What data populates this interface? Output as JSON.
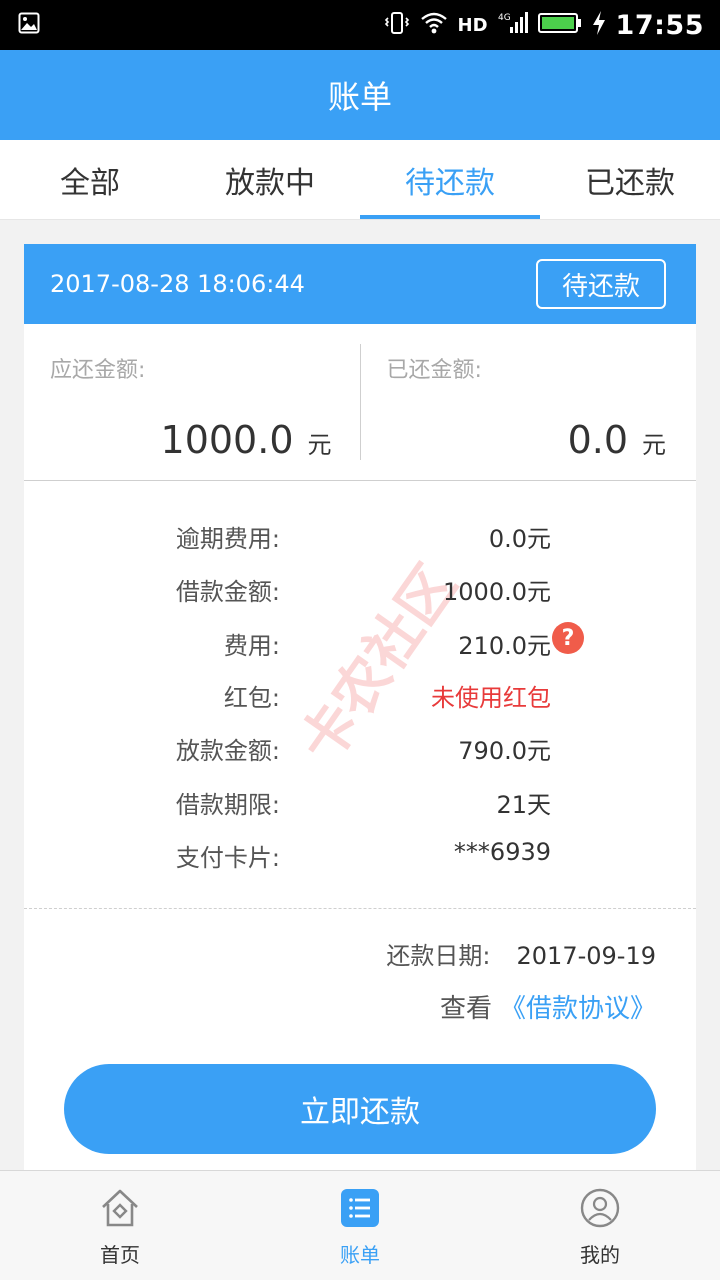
{
  "status_bar": {
    "network": "HD",
    "time": "17:55"
  },
  "header": {
    "title": "账单"
  },
  "tabs": [
    {
      "label": "全部",
      "active": false
    },
    {
      "label": "放款中",
      "active": false
    },
    {
      "label": "待还款",
      "active": true
    },
    {
      "label": "已还款",
      "active": false
    }
  ],
  "bill": {
    "datetime": "2017-08-28 18:06:44",
    "status": "待还款",
    "due_label": "应还金额:",
    "due_amount": "1000.0",
    "due_unit": "元",
    "paid_label": "已还金额:",
    "paid_amount": "0.0",
    "paid_unit": "元",
    "details": [
      {
        "label": "逾期费用:",
        "value": "0.0元"
      },
      {
        "label": "借款金额:",
        "value": "1000.0元"
      },
      {
        "label": "费用:",
        "value": "210.0元"
      },
      {
        "label": "红包:",
        "value": "未使用红包"
      },
      {
        "label": "放款金额:",
        "value": "790.0元"
      },
      {
        "label": "借款期限:",
        "value": "21天"
      },
      {
        "label": "支付卡片:",
        "value": "***6939"
      }
    ],
    "help_icon": "?",
    "watermark": "卡农社区",
    "repay_date_label": "还款日期:",
    "repay_date": "2017-09-19",
    "view_label": "查看",
    "agreement_link": "《借款协议》",
    "pay_button": "立即还款"
  },
  "bottom_nav": [
    {
      "label": "首页",
      "icon": "home-icon",
      "active": false
    },
    {
      "label": "账单",
      "icon": "list-icon",
      "active": true
    },
    {
      "label": "我的",
      "icon": "user-icon",
      "active": false
    }
  ],
  "colors": {
    "primary": "#3aa0f5",
    "red": "#e83a3a",
    "help": "#f05c4a"
  }
}
